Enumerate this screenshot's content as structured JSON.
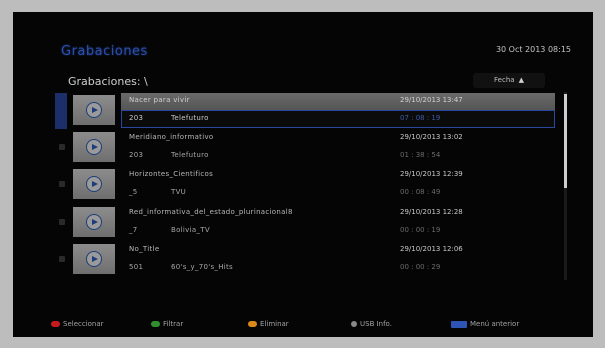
{
  "header": {
    "title": "Grabaciones",
    "datetime": "30 Oct 2013 08:15"
  },
  "browser": {
    "path": "Grabaciones: \\",
    "sort_label": "Fecha",
    "sort_arrow": "▲"
  },
  "recordings": [
    {
      "name": "Nacer para vivir",
      "channel_number": "203",
      "channel": "Telefuturo",
      "date": "29/10/2013 13:47",
      "duration": "07 : 08 : 19",
      "selected": true
    },
    {
      "name": "Meridiano_informativo",
      "channel_number": "203",
      "channel": "Telefuturo",
      "date": "29/10/2013 13:02",
      "duration": "01 : 38 : 54",
      "selected": false
    },
    {
      "name": "Horizontes_Cientificos",
      "channel_number": "_5",
      "channel": "TVU",
      "date": "29/10/2013 12:39",
      "duration": "00 : 08 : 49",
      "selected": false
    },
    {
      "name": "Red_informativa_del_estado_plurinacional8",
      "channel_number": "_7",
      "channel": "Bolivia_TV",
      "date": "29/10/2013 12:28",
      "duration": "00 : 00 : 19",
      "selected": false
    },
    {
      "name": "No_Title",
      "channel_number": "501",
      "channel": "60's_y_70's_Hits",
      "date": "29/10/2013 12:06",
      "duration": "00 : 00 : 29",
      "selected": false
    }
  ],
  "scroll_position_fraction": 0.5,
  "footer": {
    "select": {
      "label": "Seleccionar",
      "color": "#c8191f"
    },
    "filter": {
      "label": "Filtrar",
      "color": "#2f8f2f"
    },
    "delete": {
      "label": "Eliminar",
      "color": "#d98a1a"
    },
    "usb": {
      "label": "USB Info.",
      "color": "#8a8a8a"
    },
    "menu": {
      "label": "Menú anterior",
      "key": "MENU",
      "color": "#2d55b5"
    }
  }
}
